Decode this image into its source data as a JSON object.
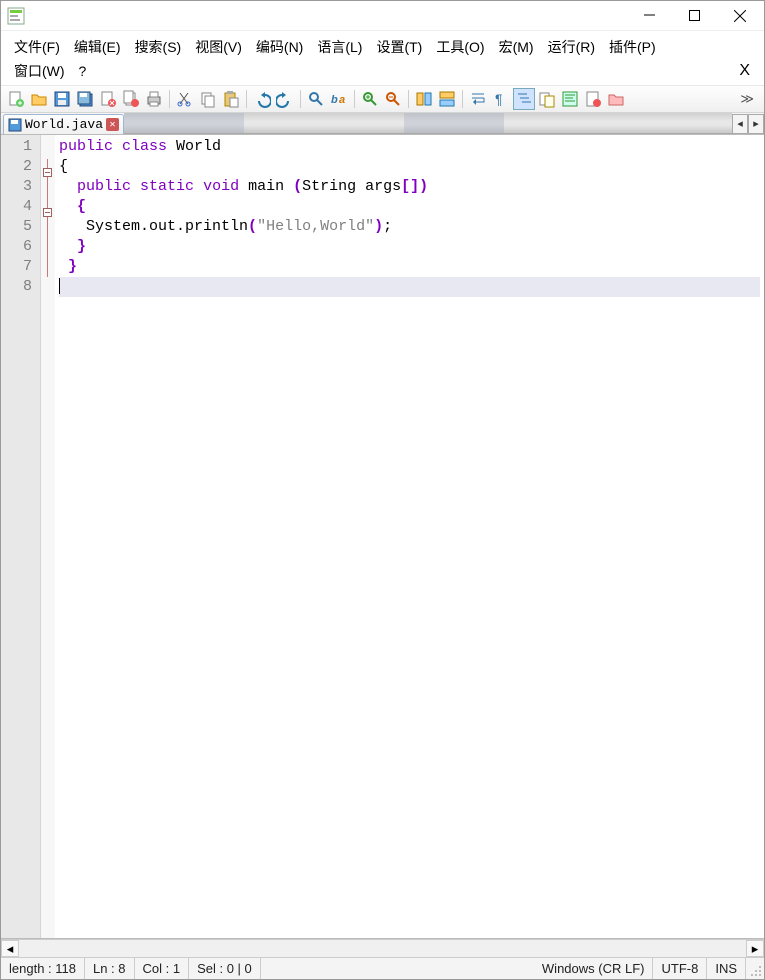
{
  "window": {
    "title": ""
  },
  "menu": {
    "items": [
      "文件(F)",
      "编辑(E)",
      "搜索(S)",
      "视图(V)",
      "编码(N)",
      "语言(L)",
      "设置(T)",
      "工具(O)",
      "宏(M)",
      "运行(R)",
      "插件(P)",
      "窗口(W)",
      "?"
    ]
  },
  "tabs": {
    "active": {
      "label": "World.java"
    }
  },
  "editor": {
    "line_count": 8,
    "lines": [
      {
        "n": 1,
        "tokens": [
          [
            "kw",
            "public"
          ],
          [
            "plain",
            " "
          ],
          [
            "kw",
            "class"
          ],
          [
            "plain",
            " World"
          ]
        ]
      },
      {
        "n": 2,
        "tokens": [
          [
            "plain",
            "{"
          ]
        ],
        "fold": "open"
      },
      {
        "n": 3,
        "tokens": [
          [
            "plain",
            "  "
          ],
          [
            "kw",
            "public"
          ],
          [
            "plain",
            " "
          ],
          [
            "kw",
            "static"
          ],
          [
            "plain",
            " "
          ],
          [
            "kw",
            "void"
          ],
          [
            "plain",
            " main "
          ],
          [
            "paren",
            "("
          ],
          [
            "plain",
            "String args"
          ],
          [
            "paren",
            "[])"
          ]
        ]
      },
      {
        "n": 4,
        "tokens": [
          [
            "plain",
            "  "
          ],
          [
            "paren",
            "{"
          ]
        ],
        "fold": "open"
      },
      {
        "n": 5,
        "tokens": [
          [
            "plain",
            "   System"
          ],
          [
            "plain",
            ".out.println"
          ],
          [
            "paren",
            "("
          ],
          [
            "str",
            "\"Hello,World\""
          ],
          [
            "paren",
            ")"
          ],
          [
            "plain",
            ";"
          ]
        ]
      },
      {
        "n": 6,
        "tokens": [
          [
            "plain",
            "  "
          ],
          [
            "paren",
            "}"
          ]
        ]
      },
      {
        "n": 7,
        "tokens": [
          [
            "plain",
            " "
          ],
          [
            "paren",
            "}"
          ]
        ]
      },
      {
        "n": 8,
        "tokens": [],
        "current": true
      }
    ]
  },
  "status": {
    "length": "length : 118",
    "ln": "Ln : 8",
    "col": "Col : 1",
    "sel": "Sel : 0 | 0",
    "eol": "Windows (CR LF)",
    "enc": "UTF-8",
    "ins": "INS"
  },
  "toolbar_overflow": "≫"
}
